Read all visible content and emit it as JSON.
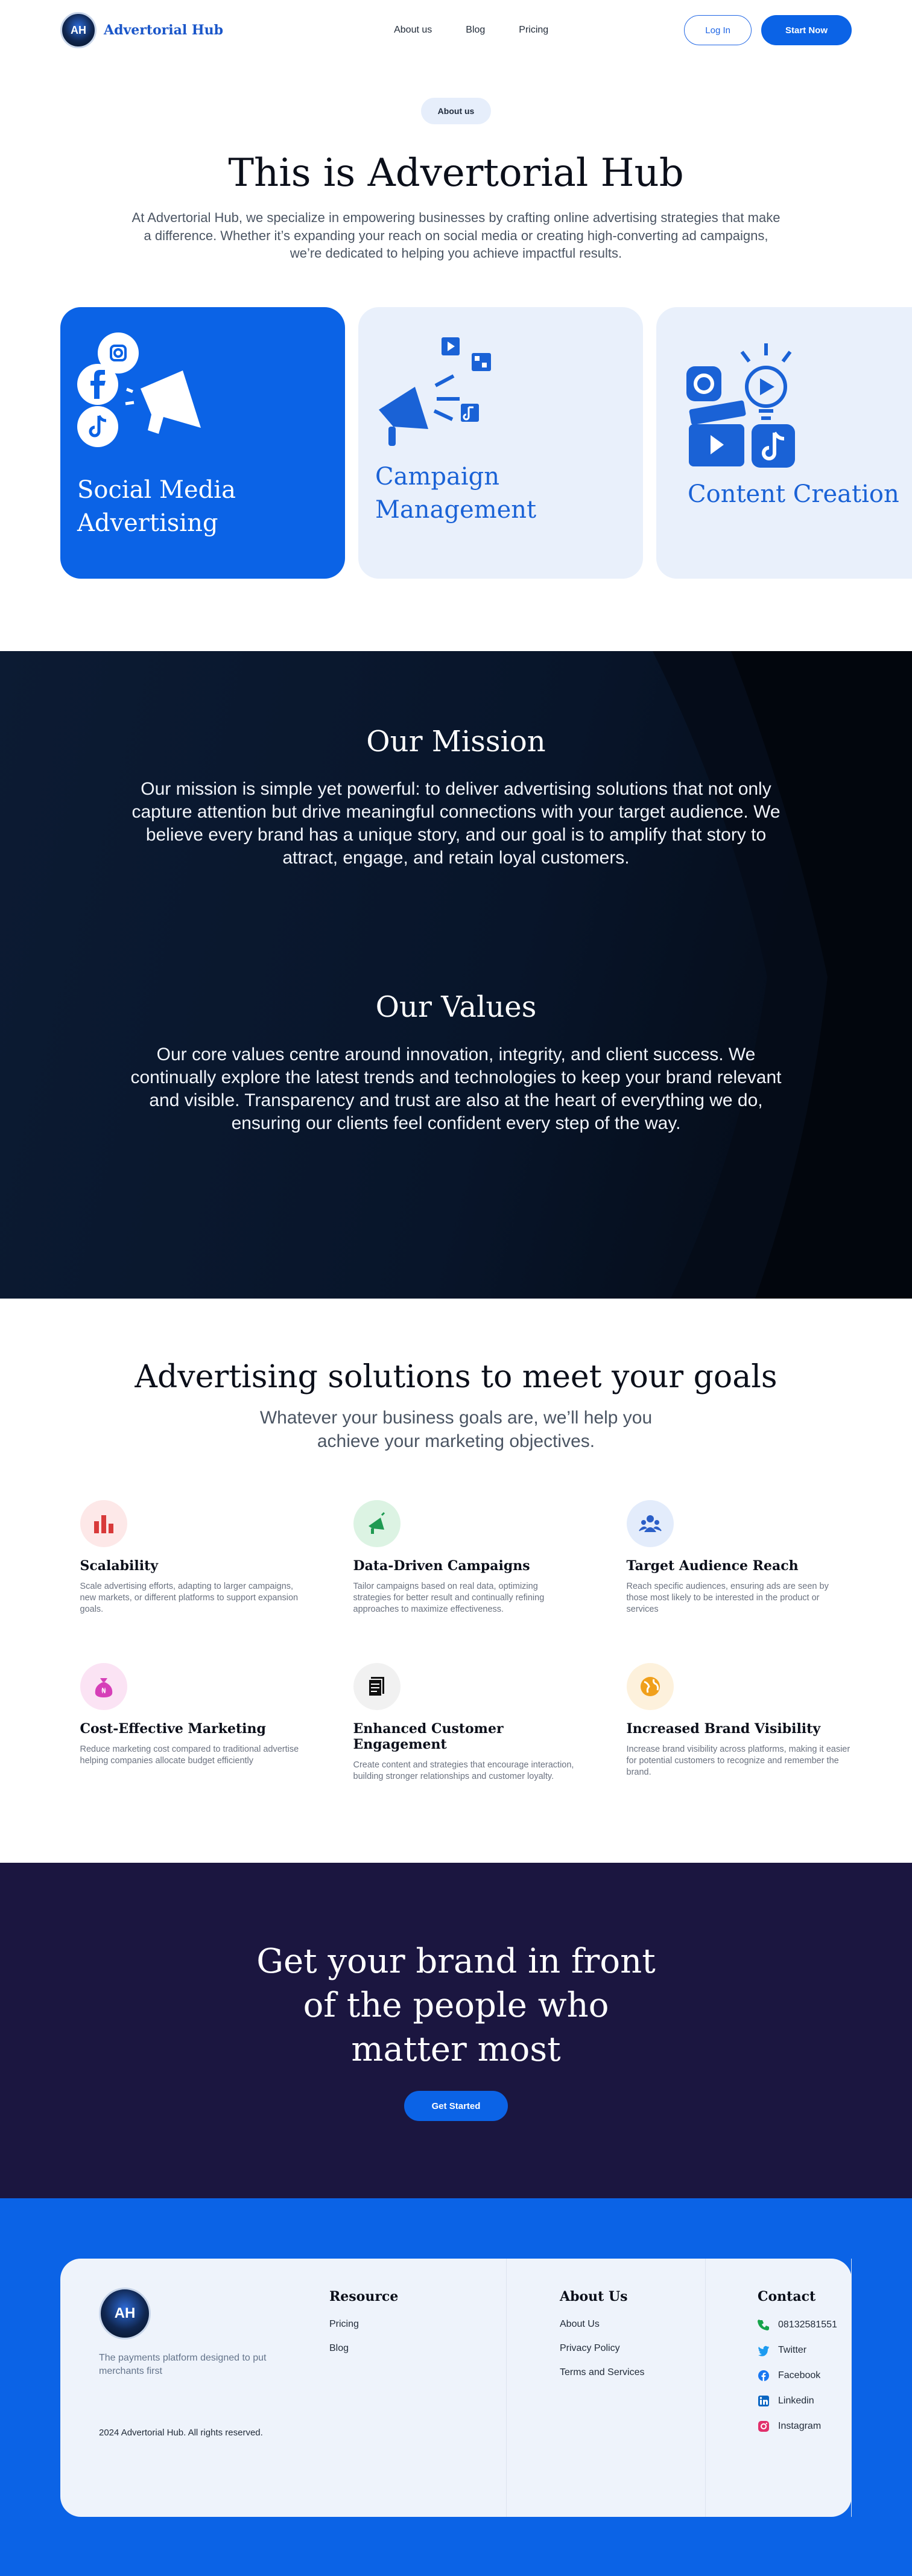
{
  "nav": {
    "brand": "Advertorial Hub",
    "logo_text": "AH",
    "links": [
      "About us",
      "Blog",
      "Pricing"
    ],
    "login": "Log In",
    "start": "Start Now"
  },
  "hero": {
    "pill": "About us",
    "title": "This is Advertorial Hub",
    "description": "At Advertorial Hub, we specialize in empowering businesses by crafting online advertising strategies that make a difference. Whether it’s expanding your reach on social media or creating high-converting ad campaigns, we’re dedicated to helping you achieve impactful results."
  },
  "services": [
    {
      "title": "Social Media Advertising",
      "icon": "social-media-megaphone-icon"
    },
    {
      "title": "Campaign Management",
      "icon": "campaign-megaphone-icon"
    },
    {
      "title": "Content Creation",
      "icon": "content-creation-icon"
    }
  ],
  "mission": {
    "title": "Our Mission",
    "text": "Our mission is simple yet powerful: to deliver advertising solutions that not only capture attention but drive meaningful connections with your target audience. We believe every brand has a unique story, and our goal is to amplify that story to attract, engage, and retain loyal customers."
  },
  "values": {
    "title": "Our Values",
    "text": "Our core values centre around innovation, integrity, and client success. We continually explore the latest trends and technologies to keep your brand relevant and visible. Transparency and trust are also at the heart of everything we do, ensuring our clients feel confident every step of the way."
  },
  "solutions": {
    "title": "Advertising solutions to meet your goals",
    "subtitle": "Whatever your business goals are, we’ll help you achieve your marketing objectives.",
    "features": [
      {
        "title": "Scalability",
        "desc": "Scale advertising efforts, adapting to larger campaigns, new markets, or different platforms to support expansion goals.",
        "icon": "bar-chart-icon",
        "bg": "#fde8e8",
        "fg": "#d83a3a"
      },
      {
        "title": "Data-Driven Campaigns",
        "desc": "Tailor campaigns based on real data, optimizing strategies for better  result and continually refining approaches to maximize effectiveness.",
        "icon": "megaphone-icon",
        "bg": "#dcf3e3",
        "fg": "#1f9a52"
      },
      {
        "title": "Target Audience Reach",
        "desc": "Reach specific audiences, ensuring ads are seen by those most likely to be interested in the product or services",
        "icon": "audience-icon",
        "bg": "#e3ecfb",
        "fg": "#2b5fc7"
      },
      {
        "title": "Cost-Effective Marketing",
        "desc": "Reduce marketing cost compared to traditional advertise helping companies allocate budget efficiently",
        "icon": "money-bag-icon",
        "bg": "#fbe3f4",
        "fg": "#d63fb8"
      },
      {
        "title": "Enhanced Customer Engagement",
        "desc": "Create content and strategies that encourage interaction, building stronger relationships and customer loyalty.",
        "icon": "document-icon",
        "bg": "#f1f1f1",
        "fg": "#111111"
      },
      {
        "title": "Increased Brand Visibility",
        "desc": "Increase brand visibility across platforms, making it easier for potential customers to recognize and remember the brand.",
        "icon": "globe-icon",
        "bg": "#fdf1dc",
        "fg": "#f0a01c"
      }
    ]
  },
  "cta": {
    "title": "Get your brand in front of the people who matter most",
    "button": "Get Started"
  },
  "footer": {
    "tagline": "The payments platform designed to put merchants first",
    "copyright": "2024 Advertorial Hub. All rights reserved.",
    "resource": {
      "title": "Resource",
      "links": [
        "Pricing",
        "Blog"
      ]
    },
    "about": {
      "title": "About Us",
      "links": [
        "About Us",
        "Privacy Policy",
        "Terms and Services"
      ]
    },
    "contact": {
      "title": "Contact",
      "items": [
        {
          "label": "08132581551",
          "icon": "phone-icon",
          "color": "#16a34a"
        },
        {
          "label": "Twitter",
          "icon": "twitter-icon",
          "color": "#1d9bf0"
        },
        {
          "label": "Facebook",
          "icon": "facebook-icon",
          "color": "#1877f2"
        },
        {
          "label": "Linkedin",
          "icon": "linkedin-icon",
          "color": "#0a66c2"
        },
        {
          "label": "Instagram",
          "icon": "instagram-icon",
          "color": "#e1306c"
        }
      ]
    }
  }
}
